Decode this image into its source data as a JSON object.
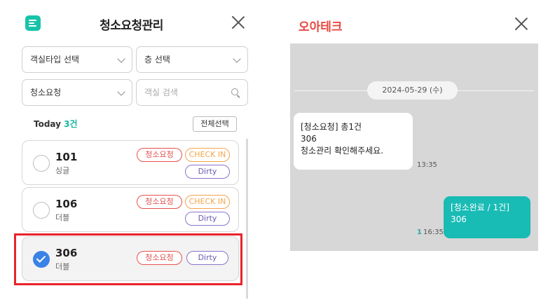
{
  "left": {
    "title": "청소요청관리",
    "filters": {
      "room_type": "객실타입 선택",
      "floor": "층 선택",
      "request": "청소요청",
      "search_placeholder": "객실 검색"
    },
    "today_label": "Today",
    "today_count": "3건",
    "select_all": "전체선택",
    "rooms": [
      {
        "number": "101",
        "type": "싱글",
        "tags": [
          "청소요청",
          "CHECK IN",
          "Dirty"
        ],
        "checked": false
      },
      {
        "number": "106",
        "type": "더블",
        "tags": [
          "청소요청",
          "CHECK IN",
          "Dirty"
        ],
        "checked": false
      },
      {
        "number": "306",
        "type": "더블",
        "tags": [
          "청소요청",
          "Dirty"
        ],
        "checked": true
      }
    ]
  },
  "right": {
    "title": "오아테크",
    "date": "2024-05-29 (수)",
    "incoming": {
      "line1": "[청소요청] 총1건",
      "line2": "306",
      "line3": "청소관리 확인해주세요.",
      "time": "13:35"
    },
    "outgoing": {
      "line1": "[청소완료 / 1건]",
      "line2": "306",
      "read_count": "1",
      "time": "16:35"
    }
  },
  "colors": {
    "accent": "#19c3a9",
    "request_tag": "#e55350",
    "checkin_tag": "#f3a54b",
    "dirty_tag": "#8a74c9",
    "selected_radio": "#3b82e6",
    "highlight": "#e8232b",
    "chat_title": "#e8473f",
    "outgoing_bubble": "#19bbb5"
  },
  "icons": {
    "menu": "menu-icon",
    "close": "close-icon",
    "chevron": "chevron-down-icon",
    "search": "search-icon",
    "check": "check-icon"
  }
}
